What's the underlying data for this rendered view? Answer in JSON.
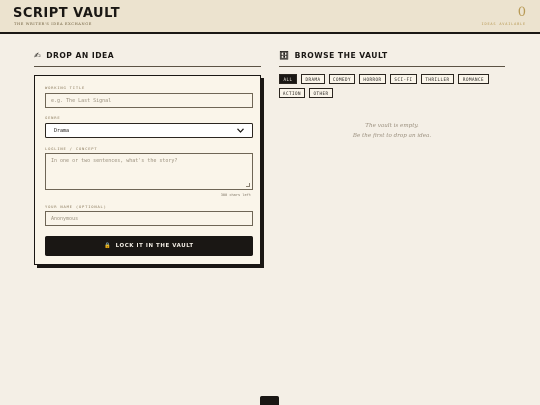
{
  "header": {
    "title": "SCRIPT VAULT",
    "subtitle": "THE WRITER'S IDEA EXCHANGE",
    "count": "0",
    "count_label": "IDEAS AVAILABLE"
  },
  "drop": {
    "title": "DROP AN IDEA",
    "icon": "writing-hand-icon",
    "working_title_label": "WORKING TITLE",
    "working_title_placeholder": "e.g. The Last Signal",
    "genre_label": "GENRE",
    "genre_value": "Drama",
    "logline_label": "LOGLINE / CONCEPT",
    "logline_placeholder": "In one or two sentences, what's the story?",
    "chars_left": "300 chars left",
    "name_label": "YOUR NAME (OPTIONAL)",
    "name_placeholder": "Anonymous",
    "submit_label": "LOCK IT IN THE VAULT",
    "submit_icon": "lock-icon"
  },
  "browse": {
    "title": "BROWSE THE VAULT",
    "icon": "file-cabinet-icon",
    "filters": [
      "ALL",
      "DRAMA",
      "COMEDY",
      "HORROR",
      "SCI-FI",
      "THRILLER",
      "ROMANCE",
      "ACTION",
      "OTHER"
    ],
    "active_filter": "ALL",
    "empty_line1": "The vault is empty.",
    "empty_line2": "Be the first to drop an idea."
  },
  "colors": {
    "background": "#f4efe6",
    "header": "#ece3cf",
    "ink": "#1a1714",
    "accent": "#b89a55"
  }
}
